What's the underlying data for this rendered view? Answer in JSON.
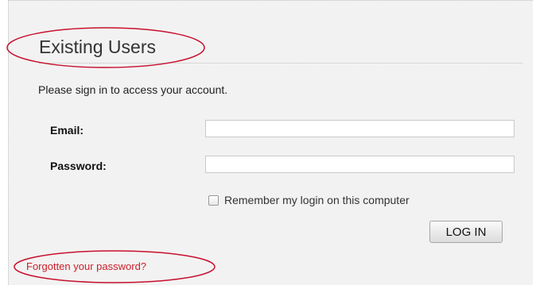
{
  "login_panel": {
    "title": "Existing Users",
    "intro_text": "Please sign in to access your account.",
    "email": {
      "label": "Email:",
      "value": "",
      "placeholder": ""
    },
    "password": {
      "label": "Password:",
      "value": "",
      "placeholder": ""
    },
    "remember_me": {
      "label": "Remember my login on this computer",
      "checked": false
    },
    "login_button_label": "LOG IN",
    "forgot_password_link": "Forgotten your password?"
  },
  "colors": {
    "panel_background": "#f2f2f2",
    "link": "#cc1f2b",
    "annotation_outline": "#c8102e"
  },
  "annotations": {
    "shape": "ellipse-outline",
    "targets": [
      "page-title",
      "forgot-password-link"
    ]
  }
}
